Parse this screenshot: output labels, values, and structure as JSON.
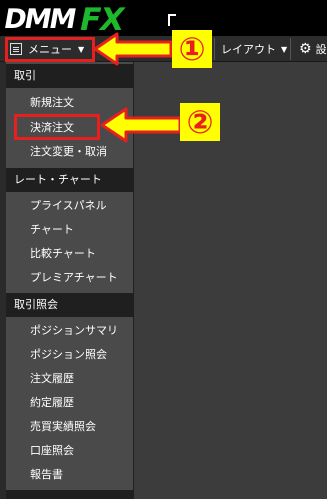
{
  "app": {
    "logo_dmm": "DMM",
    "logo_fx": "FX"
  },
  "toolbar": {
    "menu_label": "メニュー",
    "layout_label": "レイアウト",
    "settings_label": "設"
  },
  "sidemenu": {
    "sections": [
      {
        "header": "取引",
        "items": [
          "新規注文",
          "決済注文",
          "注文変更・取消"
        ]
      },
      {
        "header": "レート・チャート",
        "items": [
          "プライスパネル",
          "チャート",
          "比較チャート",
          "プレミアチャート"
        ]
      },
      {
        "header": "取引照会",
        "items": [
          "ポジションサマリ",
          "ポジション照会",
          "注文履歴",
          "約定履歴",
          "売買実績照会",
          "口座照会",
          "報告書"
        ]
      }
    ]
  },
  "annotations": {
    "badge_1": "①",
    "badge_2": "②",
    "highlight_color": "#e81f1f",
    "badge_bg": "#ffff00"
  }
}
